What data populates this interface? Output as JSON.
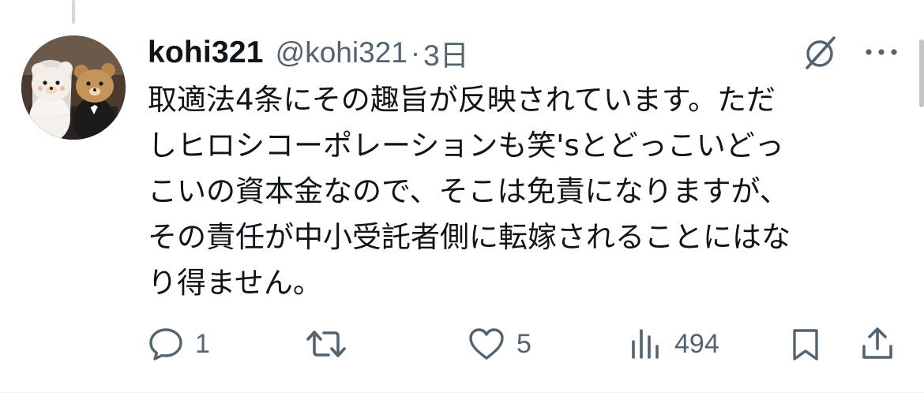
{
  "tweet": {
    "display_name": "kohi321",
    "handle": "@kohi321",
    "separator": "·",
    "time": "3日",
    "text": "取適法4条にその趣旨が反映されています。ただしヒロシコーポレーションも笑'sとどっこいどっこいの資本金なので、そこは免責になりますが、その責任が中小受託者側に転嫁されることにはなり得ません。",
    "text_lines": [
      "取適法4条にその趣旨が反映されています。ただ",
      "しヒロシコーポレーションも笑'sとどっこいどっ",
      "こいの資本金なので、そこは免責になりますが、",
      "その責任が中小受託者側に転嫁されることにはな",
      "り得ません。"
    ]
  },
  "actions": {
    "reply_count": "1",
    "retweet_count": "",
    "like_count": "5",
    "view_count": "494"
  },
  "icons": {
    "avatar": "avatar-image",
    "grok": "grok-icon",
    "more": "more-dots-icon",
    "reply": "reply-icon",
    "retweet": "retweet-icon",
    "like": "heart-icon",
    "views": "views-bar-chart-icon",
    "bookmark": "bookmark-icon",
    "share": "share-icon"
  },
  "colors": {
    "text_primary": "#0f1419",
    "text_secondary": "#536471",
    "thread_line": "#cfd9de"
  }
}
